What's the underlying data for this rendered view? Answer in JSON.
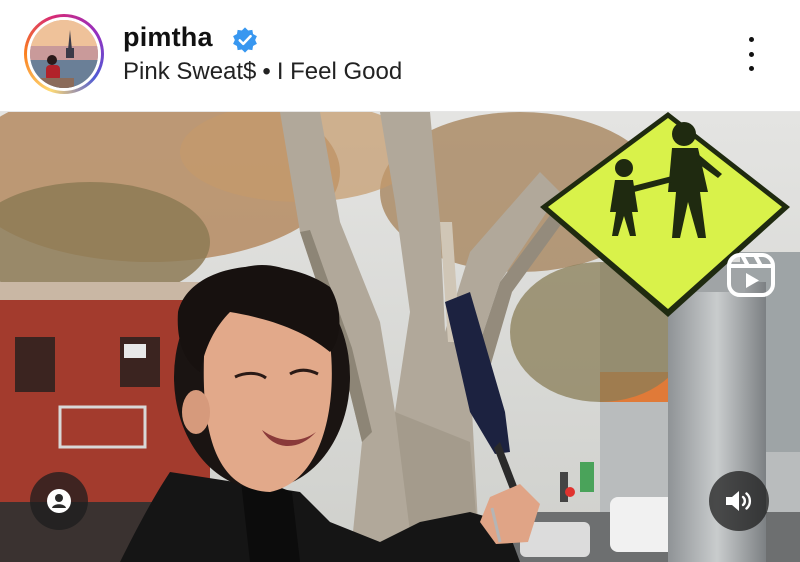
{
  "post": {
    "username": "pimtha",
    "verified": true,
    "audio_artist": "Pink Sweat$",
    "audio_separator": "•",
    "audio_track": "I Feel Good"
  },
  "icons": {
    "verified": "verified-badge-icon",
    "more": "more-options-icon",
    "reel": "reels-icon",
    "user_tags": "user-tags-icon",
    "sound": "speaker-icon"
  },
  "colors": {
    "verified_blue": "#3897f0",
    "sign_yellow": "#d9f24a"
  }
}
